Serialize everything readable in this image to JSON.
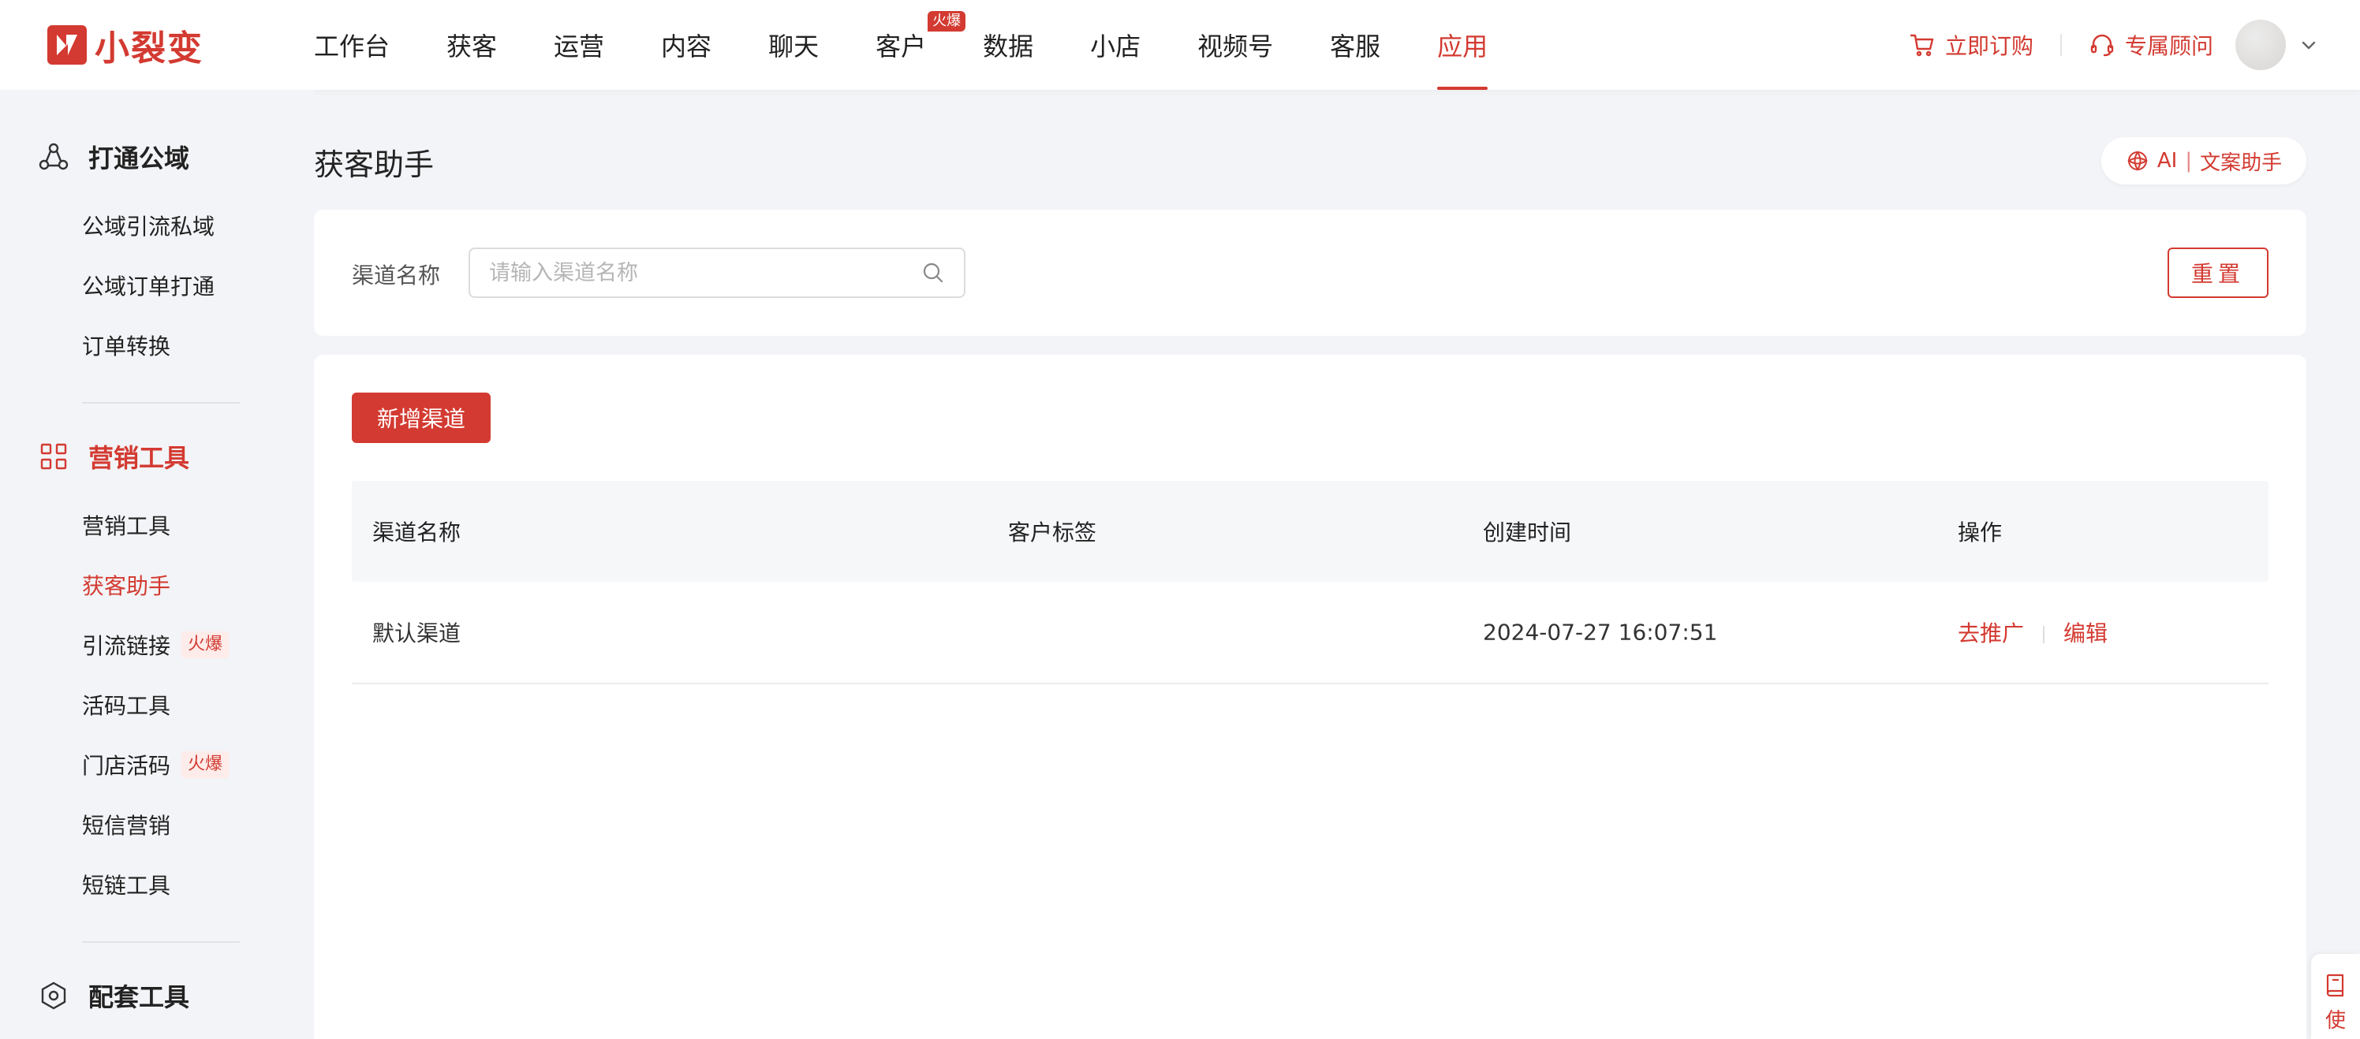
{
  "brand": {
    "name": "小裂变",
    "accent": "#d33a31"
  },
  "nav": {
    "items": [
      {
        "label": "工作台"
      },
      {
        "label": "获客"
      },
      {
        "label": "运营"
      },
      {
        "label": "内容"
      },
      {
        "label": "聊天"
      },
      {
        "label": "客户",
        "badge": "火爆"
      },
      {
        "label": "数据"
      },
      {
        "label": "小店"
      },
      {
        "label": "视频号"
      },
      {
        "label": "客服"
      },
      {
        "label": "应用",
        "active": true
      }
    ],
    "order_label": "立即订购",
    "advisor_label": "专属顾问"
  },
  "sidebar": {
    "groups": [
      {
        "title": "打通公域",
        "icon": "share-nodes-icon",
        "items": [
          {
            "label": "公域引流私域"
          },
          {
            "label": "公域订单打通"
          },
          {
            "label": "订单转换"
          }
        ]
      },
      {
        "title": "营销工具",
        "icon": "grid-icon",
        "items": [
          {
            "label": "营销工具"
          },
          {
            "label": "获客助手",
            "active": true
          },
          {
            "label": "引流链接",
            "badge": "火爆"
          },
          {
            "label": "活码工具"
          },
          {
            "label": "门店活码",
            "badge": "火爆"
          },
          {
            "label": "短信营销"
          },
          {
            "label": "短链工具"
          }
        ]
      },
      {
        "title": "配套工具",
        "icon": "hexagon-gear-icon",
        "items": []
      }
    ]
  },
  "page": {
    "title": "获客助手",
    "ai_button": {
      "ai": "AI",
      "label": "文案助手"
    }
  },
  "filter": {
    "label": "渠道名称",
    "placeholder": "请输入渠道名称",
    "value": "",
    "reset_label": "重置"
  },
  "table": {
    "add_button": "新增渠道",
    "columns": [
      "渠道名称",
      "客户标签",
      "创建时间",
      "操作"
    ],
    "rows": [
      {
        "name": "默认渠道",
        "tags": "",
        "created": "2024-07-27 16:07:51",
        "actions": [
          "去推广",
          "编辑"
        ]
      }
    ]
  },
  "float_panel": {
    "label": "使"
  }
}
